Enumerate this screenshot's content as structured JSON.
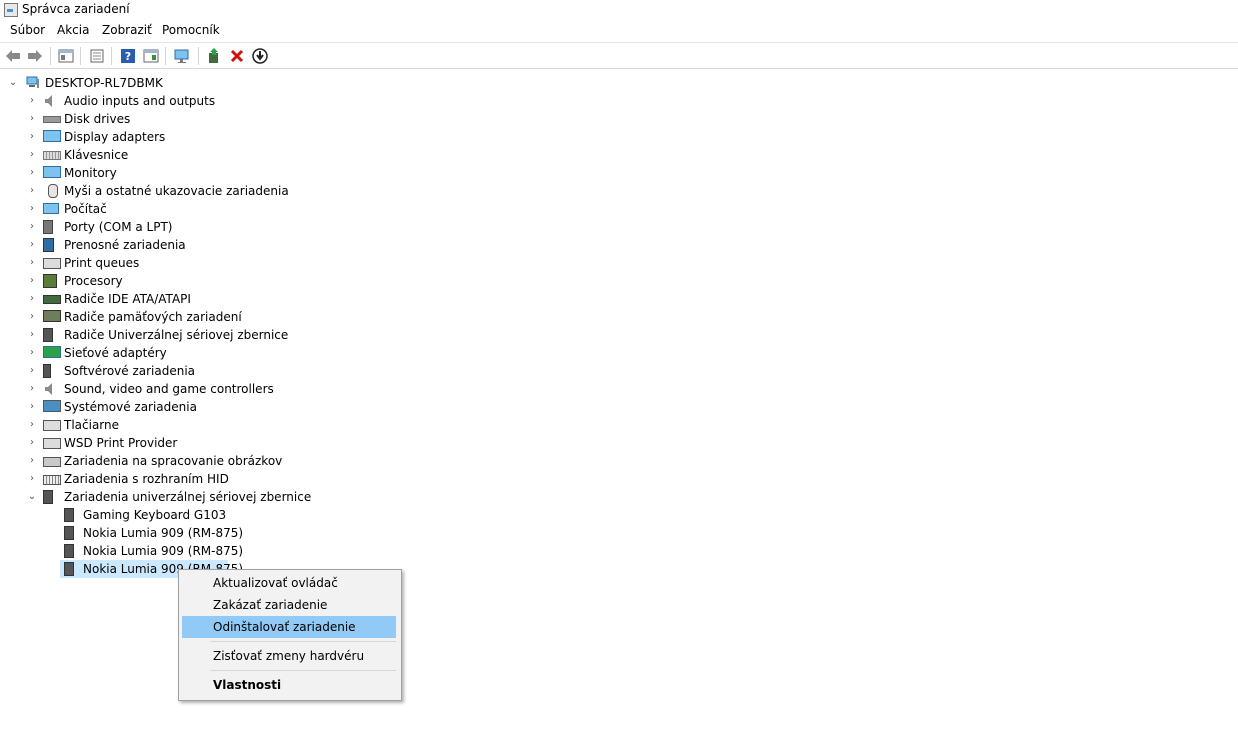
{
  "window": {
    "title": "Správca zariadení"
  },
  "menu": [
    "Súbor",
    "Akcia",
    "Zobraziť",
    "Pomocník"
  ],
  "toolbar": [
    {
      "icon": "back-arrow-icon"
    },
    {
      "icon": "forward-arrow-icon"
    },
    {
      "icon": "show-hide-console-tree-icon"
    },
    {
      "icon": "properties-icon"
    },
    {
      "icon": "help-icon"
    },
    {
      "icon": "action-pane-icon"
    },
    {
      "icon": "scan-hardware-icon"
    },
    {
      "icon": "update-driver-icon"
    },
    {
      "icon": "uninstall-x-icon"
    },
    {
      "icon": "disable-device-icon"
    }
  ],
  "tree": {
    "root": "DESKTOP-RL7DBMK",
    "categories": [
      {
        "label": "Audio inputs and outputs",
        "icon": "speaker-icon"
      },
      {
        "label": "Disk drives",
        "icon": "disk-drive-icon"
      },
      {
        "label": "Display adapters",
        "icon": "display-adapter-icon"
      },
      {
        "label": "Klávesnice",
        "icon": "keyboard-icon"
      },
      {
        "label": "Monitory",
        "icon": "monitor-icon"
      },
      {
        "label": "Myši a ostatné ukazovacie zariadenia",
        "icon": "mouse-icon"
      },
      {
        "label": "Počítač",
        "icon": "computer-icon"
      },
      {
        "label": "Porty (COM a LPT)",
        "icon": "port-icon"
      },
      {
        "label": "Prenosné zariadenia",
        "icon": "portable-device-icon"
      },
      {
        "label": "Print queues",
        "icon": "printer-icon"
      },
      {
        "label": "Procesory",
        "icon": "processor-icon"
      },
      {
        "label": "Radiče IDE ATA/ATAPI",
        "icon": "ide-controller-icon"
      },
      {
        "label": "Radiče pamäťových zariadení",
        "icon": "storage-controller-icon"
      },
      {
        "label": "Radiče Univerzálnej sériovej zbernice",
        "icon": "usb-controller-icon"
      },
      {
        "label": "Sieťové adaptéry",
        "icon": "network-adapter-icon"
      },
      {
        "label": "Softvérové zariadenia",
        "icon": "software-device-icon"
      },
      {
        "label": "Sound, video and game controllers",
        "icon": "sound-icon"
      },
      {
        "label": "Systémové zariadenia",
        "icon": "system-device-icon"
      },
      {
        "label": "Tlačiarne",
        "icon": "printer-icon"
      },
      {
        "label": "WSD Print Provider",
        "icon": "printer-icon"
      },
      {
        "label": "Zariadenia na spracovanie obrázkov",
        "icon": "imaging-device-icon"
      },
      {
        "label": "Zariadenia s rozhraním HID",
        "icon": "hid-icon"
      },
      {
        "label": "Zariadenia univerzálnej sériovej zbernice",
        "icon": "usb-device-icon",
        "expanded": true
      }
    ],
    "children": [
      {
        "label": "Gaming Keyboard G103",
        "icon": "usb-device-icon"
      },
      {
        "label": "Nokia Lumia 909 (RM-875)",
        "icon": "usb-device-icon"
      },
      {
        "label": "Nokia Lumia 909 (RM-875)",
        "icon": "usb-device-icon"
      },
      {
        "label": "Nokia Lumia 909 (RM-875)",
        "icon": "usb-device-icon",
        "selected": true
      }
    ]
  },
  "context_menu": {
    "items": [
      "Aktualizovať ovládač",
      "Zakázať zariadenie",
      "Odinštalovať zariadenie",
      "Zisťovať zmeny hardvéru",
      "Vlastnosti"
    ],
    "highlighted": "Odinštalovať zariadenie",
    "highlight_color": "#91c9f7"
  },
  "colors": {
    "selection": "#cce8ff",
    "menu_bg": "#f2f2f2"
  }
}
